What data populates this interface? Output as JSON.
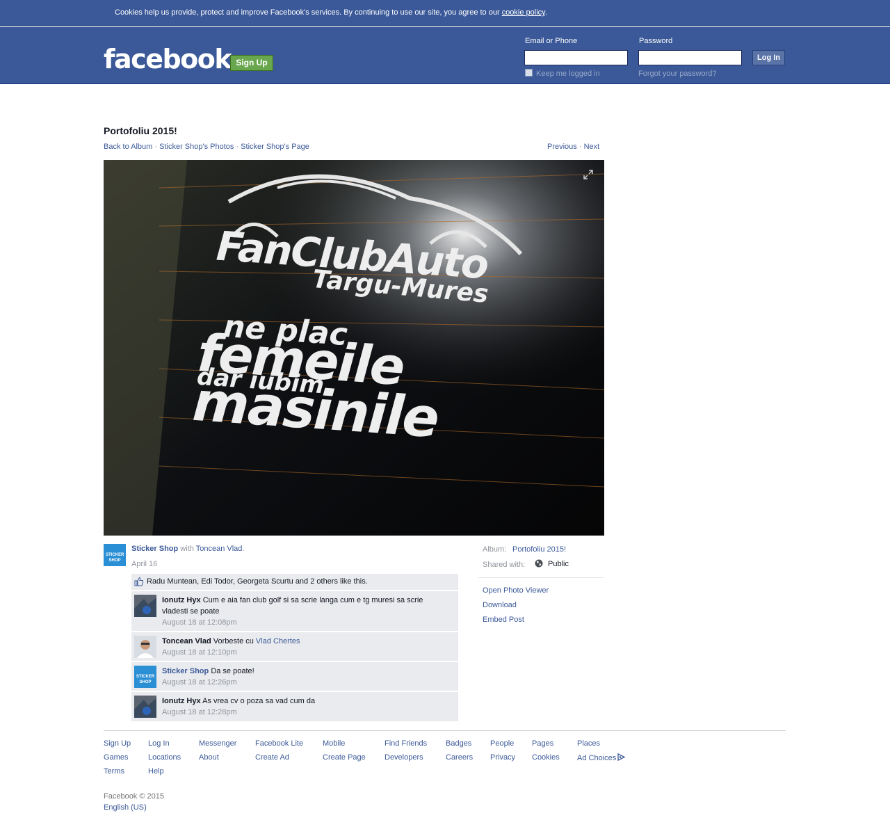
{
  "cookie_bar": {
    "text": "Cookies help us provide, protect and improve Facebook's services. By continuing to use our site, you agree to our ",
    "link": "cookie policy",
    "end": "."
  },
  "header": {
    "logo": "facebook",
    "signup_label": "Sign Up",
    "email_label": "Email or Phone",
    "password_label": "Password",
    "email_value": "",
    "password_value": "",
    "login_label": "Log In",
    "keep_logged_in": "Keep me logged in",
    "forgot_password": "Forgot your password?"
  },
  "photo_page": {
    "album_title": "Portofoliu 2015!",
    "crumbs": [
      "Back to Album",
      "Sticker Shop's Photos",
      "Sticker Shop's Page"
    ],
    "separator": " · ",
    "previous": "Previous",
    "next": "Next",
    "photo_text": {
      "line1": "FanClubAuto",
      "line2": "Targu-Mures",
      "line3": "ne plac",
      "line4": "femeile",
      "line5": "dar iubim",
      "line6": "masinile"
    }
  },
  "post": {
    "page_name": "Sticker Shop",
    "with_word": " with ",
    "tagged": "Toncean Vlad",
    "tagged_end": ".",
    "date": "April 16",
    "avatar_text": "STICKER SHOP",
    "likes_text": "Radu Muntean, Edi Todor, Georgeta Scurtu and 2 others like this.",
    "comments": [
      {
        "author": "Ionutz Hyx",
        "text": "Cum e aia fan club golf si sa scrie langa cum e tg muresi sa scrie vladesti se poate",
        "time": "August 18 at 12:08pm"
      },
      {
        "author": "Toncean Vlad",
        "text": "Vorbeste cu ",
        "mention": "Vlad Chertes",
        "time": "August 18 at 12:10pm"
      },
      {
        "author": "Sticker Shop",
        "text": "Da se poate!",
        "time": "August 18 at 12:26pm"
      },
      {
        "author": "Ionutz Hyx",
        "text": "As vrea cv o poza sa vad cum da",
        "time": "August 18 at 12:28pm"
      }
    ]
  },
  "sidebar": {
    "album_label": "Album:",
    "album_value": "Portofoliu 2015!",
    "shared_label": "Shared with:",
    "shared_value": "Public",
    "actions": [
      "Open Photo Viewer",
      "Download",
      "Embed Post"
    ]
  },
  "footer": {
    "links": [
      [
        "Sign Up",
        "Games",
        "Terms"
      ],
      [
        "Log In",
        "Locations",
        "Help"
      ],
      [
        "Messenger",
        "About"
      ],
      [
        "Facebook Lite",
        "Create Ad"
      ],
      [
        "Mobile",
        "Create Page"
      ],
      [
        "Find Friends",
        "Developers"
      ],
      [
        "Badges",
        "Careers"
      ],
      [
        "People",
        "Privacy"
      ],
      [
        "Pages",
        "Cookies"
      ],
      [
        "Places",
        "Ad Choices"
      ]
    ],
    "copyright": "Facebook © 2015",
    "language": "English (US)"
  },
  "colors": {
    "brand_blue": "#3b5998",
    "signup_green": "#69a74e",
    "comment_bg": "#e9ebee"
  }
}
